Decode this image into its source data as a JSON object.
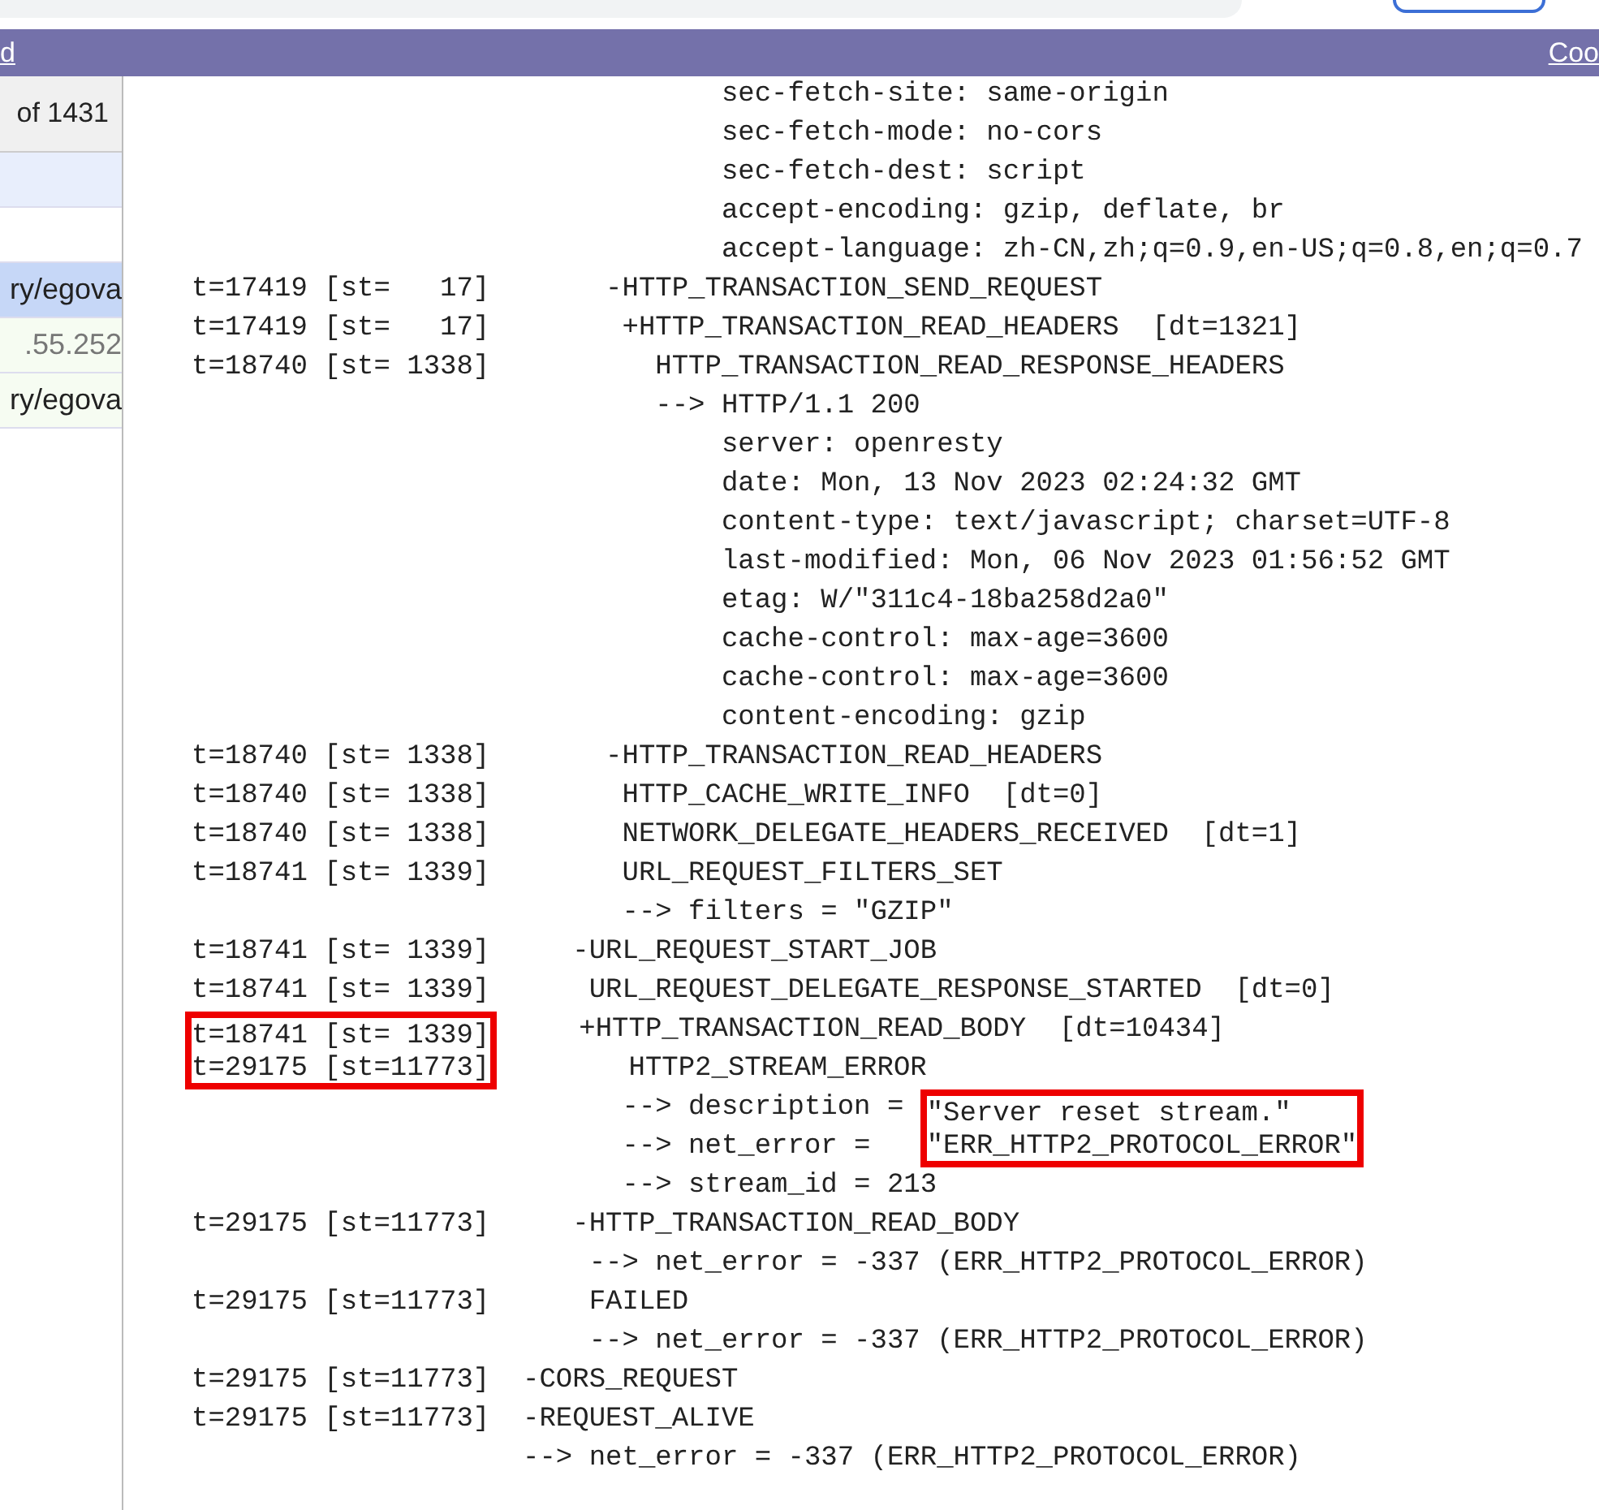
{
  "top_bar": {
    "left_link": "d",
    "right_link": "Coo"
  },
  "side_list": {
    "header": "of 1431",
    "rows": [
      {
        "selected": false,
        "kind": "filter"
      },
      {
        "selected": false,
        "kind": "blank"
      },
      {
        "text": "ry/egova",
        "selected": true,
        "kind": "url"
      },
      {
        "text": ".55.252",
        "selected": false,
        "kind": "ip"
      },
      {
        "text": "ry/egova",
        "selected": false,
        "kind": "url"
      }
    ]
  },
  "log": [
    {
      "event": "              sec-fetch-site: same-origin"
    },
    {
      "event": "              sec-fetch-mode: no-cors"
    },
    {
      "event": "              sec-fetch-dest: script"
    },
    {
      "event": "              accept-encoding: gzip, deflate, br"
    },
    {
      "event": "              accept-language: zh-CN,zh;q=0.9,en-US;q=0.8,en;q=0.7"
    },
    {
      "time": "t=17419 [st=   17]",
      "event": "       -HTTP_TRANSACTION_SEND_REQUEST"
    },
    {
      "time": "t=17419 [st=   17]",
      "event": "        +HTTP_TRANSACTION_READ_HEADERS  [dt=1321]"
    },
    {
      "time": "t=18740 [st= 1338]",
      "event": "          HTTP_TRANSACTION_READ_RESPONSE_HEADERS"
    },
    {
      "event": "          --> HTTP/1.1 200"
    },
    {
      "event": "              server: openresty"
    },
    {
      "event": "              date: Mon, 13 Nov 2023 02:24:32 GMT"
    },
    {
      "event": "              content-type: text/javascript; charset=UTF-8"
    },
    {
      "event": "              last-modified: Mon, 06 Nov 2023 01:56:52 GMT"
    },
    {
      "event": "              etag: W/\"311c4-18ba258d2a0\""
    },
    {
      "event": "              cache-control: max-age=3600"
    },
    {
      "event": "              cache-control: max-age=3600"
    },
    {
      "event": "              content-encoding: gzip"
    },
    {
      "time": "t=18740 [st= 1338]",
      "event": "       -HTTP_TRANSACTION_READ_HEADERS"
    },
    {
      "time": "t=18740 [st= 1338]",
      "event": "        HTTP_CACHE_WRITE_INFO  [dt=0]"
    },
    {
      "time": "t=18740 [st= 1338]",
      "event": "        NETWORK_DELEGATE_HEADERS_RECEIVED  [dt=1]"
    },
    {
      "time": "t=18741 [st= 1339]",
      "event": "        URL_REQUEST_FILTERS_SET"
    },
    {
      "event": "        --> filters = \"GZIP\""
    },
    {
      "time": "t=18741 [st= 1339]",
      "event": "     -URL_REQUEST_START_JOB"
    },
    {
      "time": "t=18741 [st= 1339]",
      "event": "      URL_REQUEST_DELEGATE_RESPONSE_STARTED  [dt=0]"
    },
    {
      "time": "t=18741 [st= 1339]",
      "event": "     +HTTP_TRANSACTION_READ_BODY  [dt=10434]",
      "time_boxed": true
    },
    {
      "time": "t=29175 [st=11773]",
      "event": "        HTTP2_STREAM_ERROR",
      "time_boxed": true
    },
    {
      "event": "        --> description = ",
      "value": "\"Server reset stream.\"",
      "value_boxed": true
    },
    {
      "event": "        --> net_error = ",
      "value": "\"ERR_HTTP2_PROTOCOL_ERROR\"",
      "value_boxed": true
    },
    {
      "event": "        --> stream_id = 213"
    },
    {
      "time": "t=29175 [st=11773]",
      "event": "     -HTTP_TRANSACTION_READ_BODY"
    },
    {
      "event": "      --> net_error = -337 (ERR_HTTP2_PROTOCOL_ERROR)"
    },
    {
      "time": "t=29175 [st=11773]",
      "event": "      FAILED"
    },
    {
      "event": "      --> net_error = -337 (ERR_HTTP2_PROTOCOL_ERROR)"
    },
    {
      "time": "t=29175 [st=11773]",
      "event": "  -CORS_REQUEST"
    },
    {
      "time": "t=29175 [st=11773]",
      "event": "  -REQUEST_ALIVE"
    },
    {
      "event": "  --> net_error = -337 (ERR_HTTP2_PROTOCOL_ERROR)"
    }
  ]
}
